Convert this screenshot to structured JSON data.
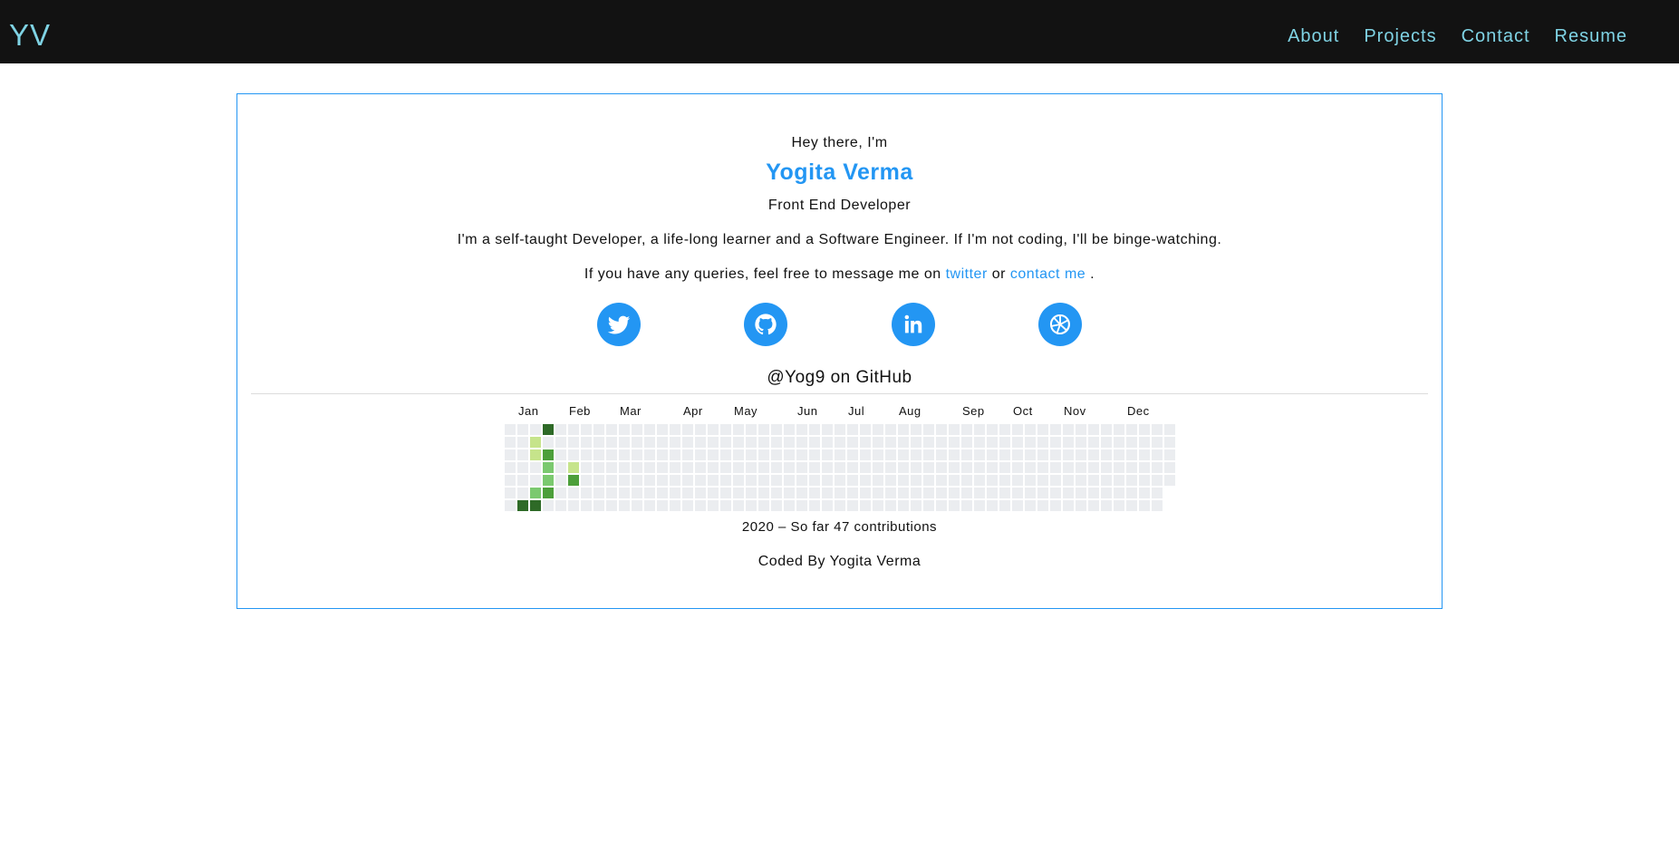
{
  "nav": {
    "logo": "YV",
    "links": [
      "About",
      "Projects",
      "Contact",
      "Resume"
    ],
    "link_color": "#7fd3e4",
    "background": "#121212"
  },
  "hero": {
    "greeting": "Hey there, I'm",
    "name": "Yogita Verma",
    "role": "Front End Developer",
    "bio": "I'm a self-taught Developer, a life-long learner and a Software Engineer. If I'm not coding, I'll be binge-watching.",
    "query_prefix": "If you have any queries, feel free to message me on",
    "twitter_link": "twitter",
    "query_or": "or",
    "contact_link": "contact me",
    "query_suffix": "."
  },
  "socials": [
    {
      "icon": "twitter-icon"
    },
    {
      "icon": "github-icon"
    },
    {
      "icon": "linkedin-icon"
    },
    {
      "icon": "sololearn-icon"
    }
  ],
  "accent_color": "#2396f3",
  "github": {
    "heading": "@Yog9 on GitHub",
    "months": [
      "Jan",
      "Feb",
      "Mar",
      "Apr",
      "May",
      "Jun",
      "Jul",
      "Aug",
      "Sep",
      "Oct",
      "Nov",
      "Dec"
    ],
    "month_start_weeks": [
      1,
      5,
      9,
      14,
      18,
      23,
      27,
      31,
      36,
      40,
      44,
      49
    ],
    "weeks": 53,
    "last_week_days": 5,
    "level_colors": [
      "#ebedf0",
      "#c6e48b",
      "#7bc96f",
      "#4c9f3a",
      "#2e6a27"
    ],
    "contributions": [
      {
        "week": 1,
        "day": 6,
        "level": 4
      },
      {
        "week": 2,
        "day": 1,
        "level": 1
      },
      {
        "week": 2,
        "day": 2,
        "level": 1
      },
      {
        "week": 2,
        "day": 5,
        "level": 2
      },
      {
        "week": 2,
        "day": 6,
        "level": 4
      },
      {
        "week": 3,
        "day": 0,
        "level": 4
      },
      {
        "week": 3,
        "day": 2,
        "level": 3
      },
      {
        "week": 3,
        "day": 3,
        "level": 2
      },
      {
        "week": 3,
        "day": 4,
        "level": 2
      },
      {
        "week": 3,
        "day": 5,
        "level": 3
      },
      {
        "week": 5,
        "day": 3,
        "level": 1
      },
      {
        "week": 5,
        "day": 4,
        "level": 3
      }
    ],
    "summary": "2020 – So far 47 contributions"
  },
  "footer": {
    "credit": "Coded By Yogita Verma"
  }
}
